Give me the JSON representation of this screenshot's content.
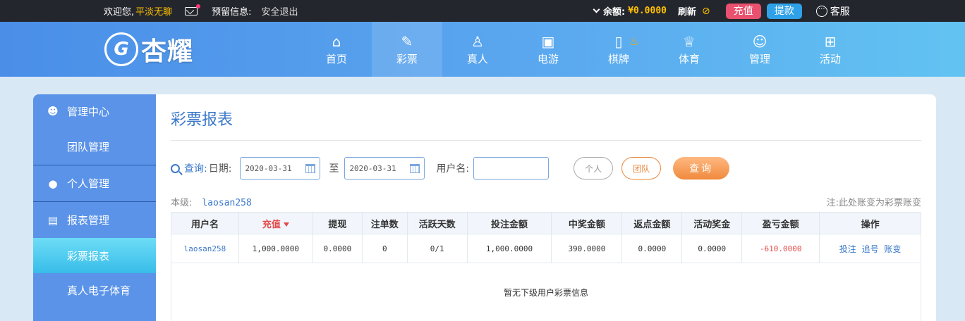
{
  "topbar": {
    "welcome": "欢迎您,",
    "username": "平淡无聊",
    "reserved_info": "预留信息:",
    "logout": "安全退出",
    "balance_label": "余额:",
    "balance_value": "¥0.0000",
    "refresh": "刷新",
    "recharge": "充值",
    "withdraw": "提款",
    "service": "客服"
  },
  "header": {
    "brand": "杏耀",
    "nav": [
      {
        "label": "首页",
        "icon": "home-icon"
      },
      {
        "label": "彩票",
        "icon": "ticket-icon"
      },
      {
        "label": "真人",
        "icon": "dealer-icon"
      },
      {
        "label": "电游",
        "icon": "slot-machine-icon"
      },
      {
        "label": "棋牌",
        "icon": "mahjong-icon"
      },
      {
        "label": "体育",
        "icon": "trophy-icon"
      },
      {
        "label": "管理",
        "icon": "users-icon"
      },
      {
        "label": "活动",
        "icon": "gift-icon"
      }
    ]
  },
  "sidebar": {
    "management_center": "管理中心",
    "team_management": "团队管理",
    "personal_management": "个人管理",
    "report_management": "报表管理",
    "lottery_report": "彩票报表",
    "live_slot_sports": "真人电子体育"
  },
  "main": {
    "title": "彩票报表",
    "query": {
      "label": "查询:",
      "date_label": "日期:",
      "start_date": "2020-03-31",
      "to": "至",
      "end_date": "2020-03-31",
      "username_label": "用户名:",
      "username_value": "",
      "personal": "个人",
      "team": "团队",
      "search": "查询"
    },
    "level_label": "本级:",
    "level_user": "laosan258",
    "note": "注:此处账变为彩票账变",
    "table": {
      "headers": [
        "用户名",
        "充值",
        "提现",
        "注单数",
        "活跃天数",
        "投注金额",
        "中奖金额",
        "返点金额",
        "活动奖金",
        "盈亏金额",
        "操作"
      ],
      "row": {
        "username": "laosan258",
        "recharge": "1,000.0000",
        "withdraw": "0.0000",
        "bets": "0",
        "active_days": "0/1",
        "bet_amount": "1,000.0000",
        "win_amount": "390.0000",
        "rebate": "0.0000",
        "bonus": "0.0000",
        "profit": "-610.0000",
        "op_bet": "投注",
        "op_chase": "追号",
        "op_account": "账变"
      },
      "empty_text": "暂无下级用户彩票信息"
    }
  }
}
